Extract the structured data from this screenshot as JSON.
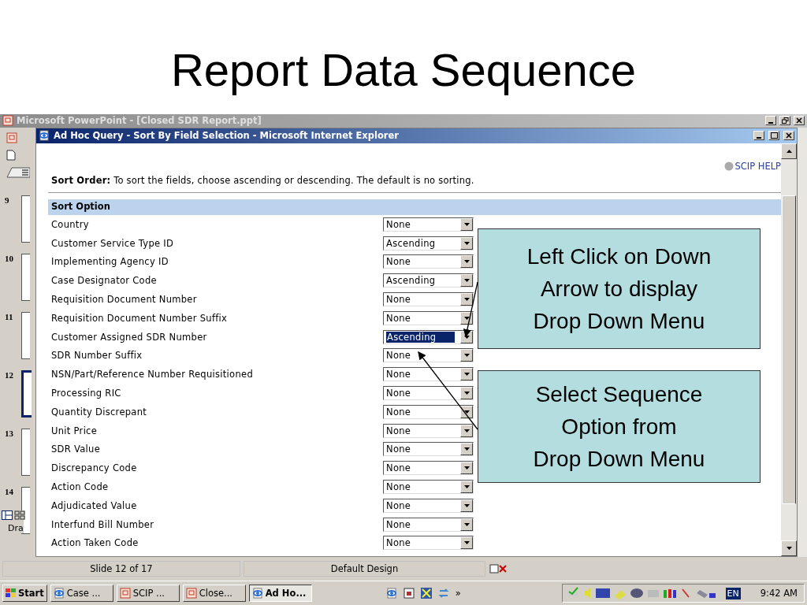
{
  "slide_title": "Report Data Sequence",
  "powerpoint": {
    "title": "Microsoft PowerPoint - [Closed SDR Report.ppt]",
    "thumbnails": [
      {
        "number": "9",
        "selected": false
      },
      {
        "number": "10",
        "selected": false
      },
      {
        "number": "11",
        "selected": false
      },
      {
        "number": "12",
        "selected": true
      },
      {
        "number": "13",
        "selected": false
      },
      {
        "number": "14",
        "selected": false
      }
    ],
    "draw_label": "Dra",
    "status_bar": [
      "Slide 12 of 17",
      "Default Design"
    ]
  },
  "browser": {
    "title": "Ad Hoc Query - Sort By Field Selection - Microsoft Internet Explorer",
    "help_link": "SCIP HELP",
    "intro": "**Sort Order:** To sort the fields, choose ascending or descending. The default is no sorting.",
    "section_header": "Sort Option",
    "rows": [
      {
        "label": "Country",
        "value": "None",
        "focused": false
      },
      {
        "label": "Customer Service Type ID",
        "value": "Ascending",
        "focused": false
      },
      {
        "label": "Implementing Agency ID",
        "value": "None",
        "focused": false
      },
      {
        "label": "Case Designator Code",
        "value": "Ascending",
        "focused": false
      },
      {
        "label": "Requisition Document Number",
        "value": "None",
        "focused": false
      },
      {
        "label": "Requisition Document Number Suffix",
        "value": "None",
        "focused": false
      },
      {
        "label": "Customer Assigned SDR Number",
        "value": "Ascending",
        "focused": true
      },
      {
        "label": "SDR Number Suffix",
        "value": "None",
        "focused": false
      },
      {
        "label": "NSN/Part/Reference Number Requisitioned",
        "value": "None",
        "focused": false
      },
      {
        "label": "Processing RIC",
        "value": "None",
        "focused": false
      },
      {
        "label": "Quantity Discrepant",
        "value": "None",
        "focused": false
      },
      {
        "label": "Unit Price",
        "value": "None",
        "focused": false
      },
      {
        "label": "SDR Value",
        "value": "None",
        "focused": false
      },
      {
        "label": "Discrepancy Code",
        "value": "None",
        "focused": false
      },
      {
        "label": "Action Code",
        "value": "None",
        "focused": false
      },
      {
        "label": "Adjudicated Value",
        "value": "None",
        "focused": false
      },
      {
        "label": "Interfund Bill Number",
        "value": "None",
        "focused": false
      },
      {
        "label": "Action Taken Code",
        "value": "None",
        "focused": false
      }
    ]
  },
  "callouts": [
    {
      "lines": [
        "Left Click on Down",
        "Arrow to display",
        "Drop Down Menu"
      ]
    },
    {
      "lines": [
        "Select Sequence",
        "Option from",
        "Drop Down Menu"
      ]
    }
  ],
  "taskbar": {
    "start": "Start",
    "tasks": [
      {
        "label": "Case ...",
        "kind": "browser",
        "selected": false
      },
      {
        "label": "SCIP ...",
        "kind": "presentation",
        "selected": false
      },
      {
        "label": "Close...",
        "kind": "presentation",
        "selected": false
      },
      {
        "label": "Ad Ho...",
        "kind": "browser",
        "selected": true
      }
    ],
    "overflow": "»",
    "language": "EN",
    "clock": "9:42 AM"
  }
}
